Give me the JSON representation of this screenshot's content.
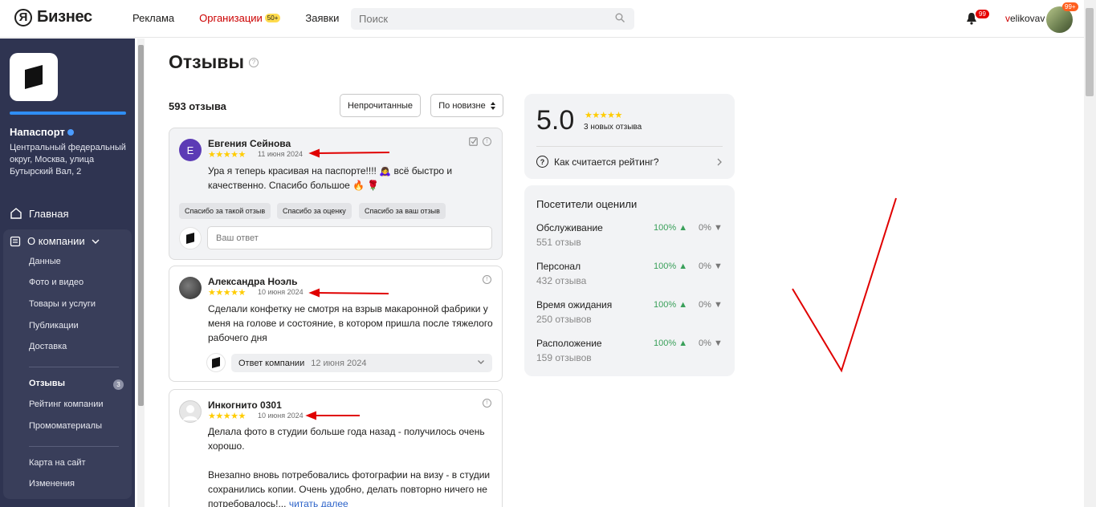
{
  "header": {
    "logo_y": "Я",
    "logo_text": "Бизнес",
    "nav": [
      {
        "label": "Реклама"
      },
      {
        "label": "Организации",
        "badge": "50+"
      },
      {
        "label": "Заявки"
      }
    ],
    "search_placeholder": "Поиск",
    "bell_badge": "99",
    "user_first": "v",
    "user_rest": "elikovav",
    "avatar_badge": "99+"
  },
  "sidebar": {
    "org_name": "Напаспорт",
    "address": "Центральный федеральный округ, Москва, улица Бутырский Вал, 2",
    "home": "Главная",
    "group_title": "О компании",
    "items": [
      "Данные",
      "Фото и видео",
      "Товары и услуги",
      "Публикации",
      "Доставка"
    ],
    "reviews": "Отзывы",
    "reviews_count": "3",
    "items2": [
      "Рейтинг компании",
      "Промоматериалы"
    ],
    "items3": [
      "Карта на сайт",
      "Изменения"
    ]
  },
  "main": {
    "title": "Отзывы",
    "count": "593 отзыва",
    "filter_unread": "Непрочитанные",
    "sort": "По новизне"
  },
  "reviews": [
    {
      "initial": "Е",
      "name": "Евгения Сейнова",
      "stars": "★★★★★",
      "date": "11 июня 2024",
      "text_1": "Ура я теперь красивая на паспорте!!!! 🙇‍♀️  всё быстро и",
      "text_2": "качественно. Спасибо большое 🔥 🌹",
      "chips": [
        "Спасибо за такой отзыв",
        "Спасибо за оценку",
        "Спасибо за ваш отзыв"
      ],
      "reply_placeholder": "Ваш ответ"
    },
    {
      "name": "Александра Ноэль",
      "stars": "★★★★★",
      "date": "10 июня 2024",
      "text_1": "Сделали конфетку не смотря на взрыв макаронной фабрики у",
      "text_2": "меня на голове и состояние, в котором пришла после тяжелого",
      "text_3": "рабочего дня",
      "company_reply": "Ответ компании",
      "company_reply_date": "12 июня 2024"
    },
    {
      "name": "Инкогнито 0301",
      "stars": "★★★★★",
      "date": "10 июня 2024",
      "text_1": "Делала фото в студии больше года назад - получилось очень",
      "text_2": "хорошо.",
      "text_3": "Внезапно вновь потребовались фотографии на визу - в студии",
      "text_4": "сохранились копии. Очень удобно, делать повторно ничего не",
      "text_5": "потребовалось!...",
      "more": "читать далее"
    }
  ],
  "rating": {
    "value": "5.0",
    "stars": "★★★★★",
    "new_reviews": "3 новых отзыва",
    "how": "Как считается рейтинг?"
  },
  "visitors": {
    "title": "Посетители оценили",
    "criteria": [
      {
        "name": "Обслуживание",
        "count": "551 отзыв",
        "pos": "100%",
        "neg": "0%"
      },
      {
        "name": "Персонал",
        "count": "432 отзыва",
        "pos": "100%",
        "neg": "0%"
      },
      {
        "name": "Время ожидания",
        "count": "250 отзывов",
        "pos": "100%",
        "neg": "0%"
      },
      {
        "name": "Расположение",
        "count": "159 отзывов",
        "pos": "100%",
        "neg": "0%"
      }
    ]
  },
  "colors": {
    "accent_red": "#cc0000",
    "sidebar_bg": "#2f3451",
    "star": "#ffcc00",
    "positive": "#3aa05a"
  }
}
